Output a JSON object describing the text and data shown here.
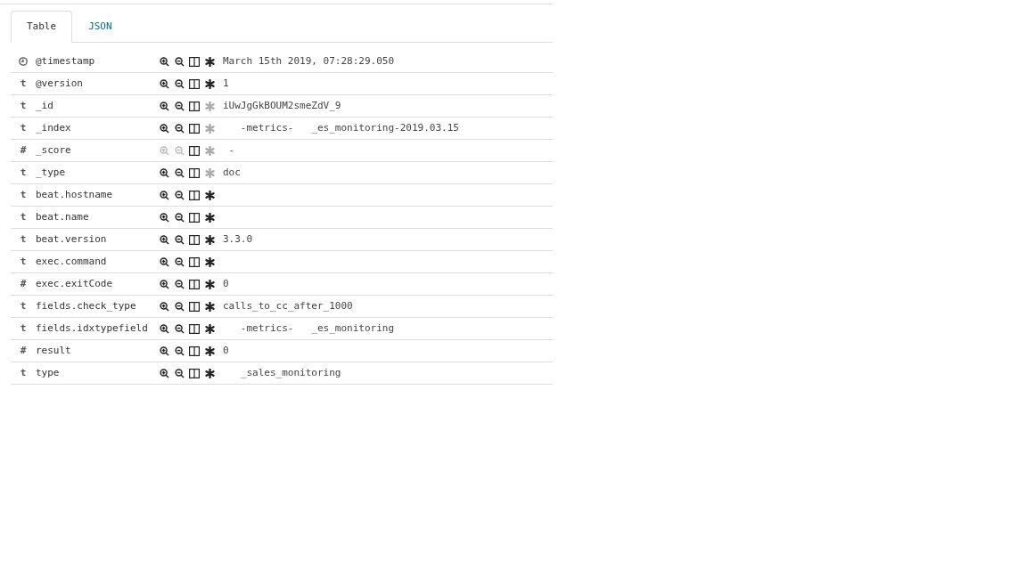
{
  "tabs": [
    {
      "label": "Table",
      "selected": true
    },
    {
      "label": "JSON",
      "selected": false
    }
  ],
  "rows": [
    {
      "kind": "date",
      "field": "@timestamp",
      "value": "March 15th 2019, 07:28:29.050",
      "filterable": true,
      "exists_filterable": true
    },
    {
      "kind": "string",
      "type_label": "t",
      "field": "@version",
      "value": "1",
      "filterable": true,
      "exists_filterable": true
    },
    {
      "kind": "string",
      "type_label": "t",
      "field": "_id",
      "value": "iUwJgGkBOUM2smeZdV_9",
      "filterable": true,
      "exists_filterable": false
    },
    {
      "kind": "string",
      "type_label": "t",
      "field": "_index",
      "value": "   -metrics-   _es_monitoring-2019.03.15",
      "filterable": true,
      "exists_filterable": false
    },
    {
      "kind": "number",
      "type_label": "#",
      "field": "_score",
      "value": " -",
      "filterable": false,
      "exists_filterable": false
    },
    {
      "kind": "string",
      "type_label": "t",
      "field": "_type",
      "value": "doc",
      "filterable": true,
      "exists_filterable": false
    },
    {
      "kind": "string",
      "type_label": "t",
      "field": "beat.hostname",
      "filterable": true,
      "exists_filterable": true
    },
    {
      "kind": "string",
      "type_label": "t",
      "field": "beat.name",
      "filterable": true,
      "exists_filterable": true
    },
    {
      "kind": "string",
      "type_label": "t",
      "field": "beat.version",
      "value": "3.3.0",
      "filterable": true,
      "exists_filterable": true
    },
    {
      "kind": "string",
      "type_label": "t",
      "field": "exec.command",
      "filterable": true,
      "exists_filterable": true
    },
    {
      "kind": "number",
      "type_label": "#",
      "field": "exec.exitCode",
      "value": "0",
      "filterable": true,
      "exists_filterable": true
    },
    {
      "kind": "string",
      "type_label": "t",
      "field": "fields.check_type",
      "value": "calls_to_cc_after_1000",
      "filterable": true,
      "exists_filterable": true
    },
    {
      "kind": "string",
      "type_label": "t",
      "field": "fields.idxtypefield",
      "value": "   -metrics-   _es_monitoring",
      "filterable": true,
      "exists_filterable": true
    },
    {
      "kind": "number",
      "type_label": "#",
      "field": "result",
      "value": "0",
      "filterable": true,
      "exists_filterable": true
    },
    {
      "kind": "string",
      "type_label": "t",
      "field": "type",
      "value": "   _sales_monitoring",
      "filterable": true,
      "exists_filterable": true
    }
  ]
}
